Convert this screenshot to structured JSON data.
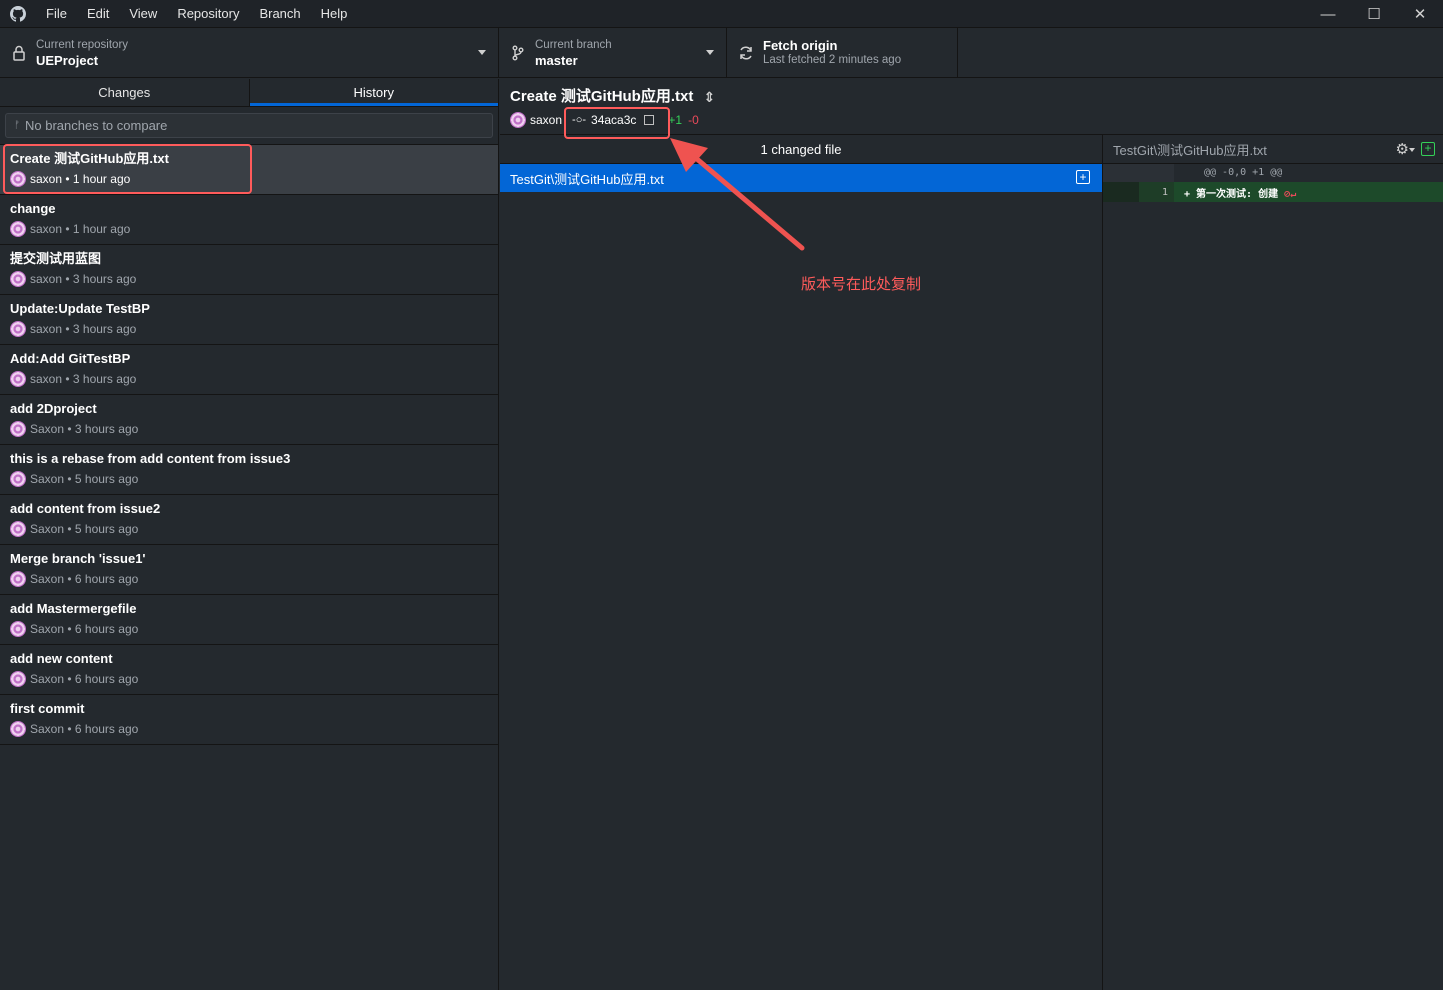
{
  "menu": [
    "File",
    "Edit",
    "View",
    "Repository",
    "Branch",
    "Help"
  ],
  "window_controls": {
    "minimize": "—",
    "maximize": "☐",
    "close": "✕"
  },
  "toolbar": {
    "repo": {
      "sub": "Current repository",
      "main": "UEProject"
    },
    "branch": {
      "sub": "Current branch",
      "main": "master"
    },
    "fetch": {
      "main": "Fetch origin",
      "sub": "Last fetched 2 minutes ago"
    }
  },
  "tabs": {
    "changes": "Changes",
    "history": "History"
  },
  "compare": {
    "placeholder": "No branches to compare"
  },
  "commits": [
    {
      "title": "Create 测试GitHub应用.txt",
      "author": "saxon",
      "time": "1 hour ago"
    },
    {
      "title": "change",
      "author": "saxon",
      "time": "1 hour ago"
    },
    {
      "title": "提交测试用蓝图",
      "author": "saxon",
      "time": "3 hours ago"
    },
    {
      "title": "Update:Update TestBP",
      "author": "saxon",
      "time": "3 hours ago"
    },
    {
      "title": "Add:Add GitTestBP",
      "author": "saxon",
      "time": "3 hours ago"
    },
    {
      "title": "add 2Dproject",
      "author": "Saxon",
      "time": "3 hours ago"
    },
    {
      "title": "this is a rebase from add content from issue3",
      "author": "Saxon",
      "time": "5 hours ago"
    },
    {
      "title": "add content from issue2",
      "author": "Saxon",
      "time": "5 hours ago"
    },
    {
      "title": "Merge branch 'issue1'",
      "author": "Saxon",
      "time": "6 hours ago"
    },
    {
      "title": "add Mastermergefile",
      "author": "Saxon",
      "time": "6 hours ago"
    },
    {
      "title": "add new content",
      "author": "Saxon",
      "time": "6 hours ago"
    },
    {
      "title": "first commit",
      "author": "Saxon",
      "time": "6 hours ago"
    }
  ],
  "detail": {
    "title": "Create 测试GitHub应用.txt",
    "author": "saxon",
    "sha": "34aca3c",
    "added": "+1",
    "removed": "-0"
  },
  "files": {
    "header": "1 changed file",
    "items": [
      "TestGit\\测试GitHub应用.txt"
    ]
  },
  "diff": {
    "path": "TestGit\\测试GitHub应用.txt",
    "hunk": "@@ -0,0 +1 @@",
    "line_no": "1",
    "line": "+  第一次测试: 创建"
  },
  "annotation": "版本号在此处复制",
  "colors": {
    "accent": "#0366d6",
    "highlight": "#ff5b5b",
    "added": "#34d058",
    "removed": "#ea4a5a"
  }
}
